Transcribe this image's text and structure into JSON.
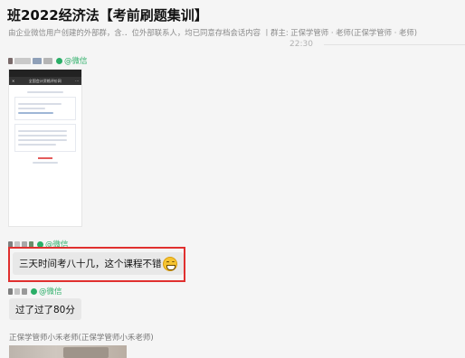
{
  "header": {
    "title": "班2022经济法【考前刷题集训】",
    "subtitle": "由企业微信用户创建的外部群，含.．位外部联系人，均已同意存档会话内容  丨群主: 正保学管师 · 老师(正保学管师 · 老师)"
  },
  "timestamp": "22:30",
  "messages": [
    {
      "sender_tag": "@微信",
      "image": {
        "page_title": "全国会计资格评价网",
        "icon": "phone-screenshot-thumbnail"
      }
    },
    {
      "sender_tag": "@微信",
      "text": "三天时间考八十几，这个课程不错",
      "emoji": "grin-emoji",
      "highlighted": true,
      "highlight_color": "#e0302f"
    },
    {
      "sender_tag": "@微信",
      "text": "过了过了80分"
    },
    {
      "sender_name": "正保学管师小禾老师(正保学管师小禾老师)"
    }
  ],
  "colors": {
    "wechat_green": "#2aae67",
    "bubble": "#e8e8e8",
    "background": "#f5f5f5"
  }
}
